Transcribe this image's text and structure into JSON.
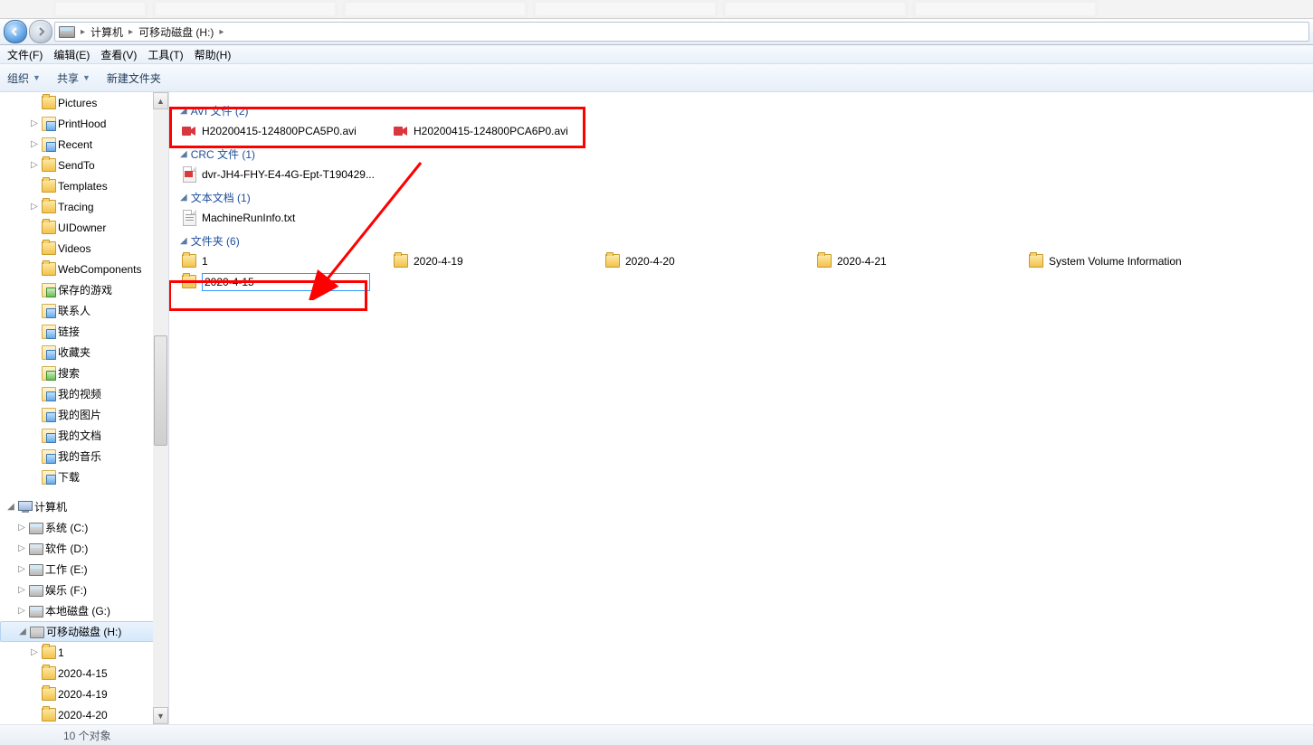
{
  "breadcrumb": {
    "root": "计算机",
    "drive": "可移动磁盘 (H:)"
  },
  "menu": {
    "file": "文件(F)",
    "edit": "编辑(E)",
    "view": "查看(V)",
    "tools": "工具(T)",
    "help": "帮助(H)"
  },
  "toolbar": {
    "organize": "组织",
    "share": "共享",
    "newfolder": "新建文件夹"
  },
  "tree": {
    "pictures": "Pictures",
    "printhood": "PrintHood",
    "recent": "Recent",
    "sendto": "SendTo",
    "templates": "Templates",
    "tracing": "Tracing",
    "uidowner": "UIDowner",
    "videos": "Videos",
    "webcomponents": "WebComponents",
    "savedgames": "保存的游戏",
    "contacts": "联系人",
    "links": "链接",
    "favorites": "收藏夹",
    "searches": "搜索",
    "myvideos": "我的视频",
    "mypictures": "我的图片",
    "mydocs": "我的文档",
    "mymusic": "我的音乐",
    "downloads": "下载",
    "computer": "计算机",
    "sysC": "系统 (C:)",
    "softD": "软件 (D:)",
    "workE": "工作 (E:)",
    "entF": "娱乐 (F:)",
    "localG": "本地磁盘 (G:)",
    "removH": "可移动磁盘 (H:)",
    "f1": "1",
    "f2": "2020-4-15",
    "f3": "2020-4-19",
    "f4": "2020-4-20"
  },
  "groups": {
    "avi": "AVI 文件 (2)",
    "crc": "CRC 文件 (1)",
    "txt": "文本文档 (1)",
    "folders": "文件夹 (6)"
  },
  "files": {
    "avi1": "H20200415-124800PCA5P0.avi",
    "avi2": "H20200415-124800PCA6P0.avi",
    "crc1": "dvr-JH4-FHY-E4-4G-Ept-T190429...",
    "txt1": "MachineRunInfo.txt"
  },
  "folders": {
    "a": "1",
    "b": "2020-4-19",
    "c": "2020-4-20",
    "d": "2020-4-21",
    "e": "System Volume Information",
    "rename_value": "2020-4-15"
  },
  "status": {
    "objects": "10 个对象"
  }
}
